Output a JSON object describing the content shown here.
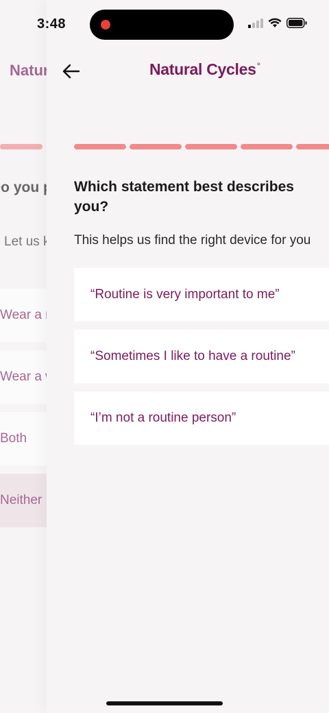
{
  "status_bar": {
    "time": "3:48",
    "icons": [
      "cellular-signal-icon",
      "wifi-icon",
      "battery-icon"
    ]
  },
  "previous_screen": {
    "logo": "Natural Cycles°",
    "question": "Do you prefer to keep wearing...",
    "subtitle": "Let us know...",
    "options": [
      {
        "label": "Wear a ring"
      },
      {
        "label": "Wear a watch"
      },
      {
        "label": "Both"
      },
      {
        "label": "Neither",
        "selected": true
      }
    ]
  },
  "current_screen": {
    "logo": "Natural Cycles",
    "logo_mark": "°",
    "back_icon": "arrow-left-icon",
    "progress_segments": 5,
    "question": "Which statement best describes you?",
    "subtitle": "This helps us find the right device for you",
    "options": [
      {
        "label": "“Routine is very important to me”"
      },
      {
        "label": "“Sometimes I like to have a routine”"
      },
      {
        "label": "“I’m not a routine person”"
      }
    ]
  },
  "colors": {
    "brand": "#7a1b5c",
    "progress": "#f28a8a",
    "background": "#f7f4f5",
    "card": "#ffffff",
    "selected_card": "#ecdde2"
  }
}
